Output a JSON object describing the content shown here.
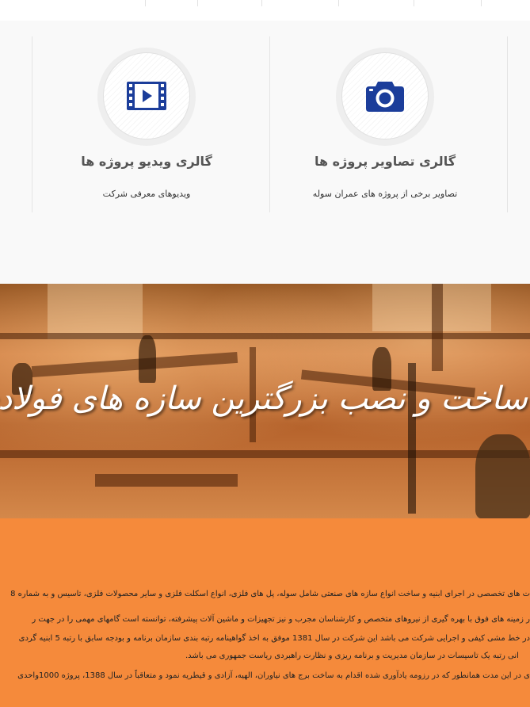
{
  "cards": [
    {
      "title": "گالری تصاویر پروژه ها",
      "subtitle": "تصاویر برخی از پروژه های عمران سوله",
      "icon": "camera-icon"
    },
    {
      "title": "گالری ویدیو پروژه ها",
      "subtitle": "ویدیوهای معرفی شرکت",
      "icon": "film-icon"
    }
  ],
  "banner": {
    "title": "ساخت و نصب بزرگترین سازه های فولادی"
  },
  "about": {
    "lines": [
      "ت های تخصصی در اجرای ابنیه و ساخت انواع سازه های صنعتی شامل سوله، پل های فلزی، انواع اسکلت فلزی و سایر محصولات فلزی، تاسیس و به شماره 8",
      "ر زمینه های فوق با بهره گیری از نیروهای متخصص و کارشناسان مجرب و نیز تجهیزات و ماشین آلات پیشرفته، توانسته است گامهای مهمی را در جهت ر",
      "در خط مشی کیفی و اجرایی شرکت می باشد این شرکت در سال 1381 موفق به اخذ گواهینامه رتبه بندی سازمان برنامه و بودجه سابق با رتبه 5 ابنیه گردی",
      "انی رتبه یک تاسیسات در سازمان مدیریت و برنامه ریزی و نظارت راهبردی ریاست جمهوری می باشد.",
      "ی در این مدت همانطور که در رزومه یادآوری شده اقدام به ساخت برج های نیاوران، الهیه، آزادی و قیطریه نمود و متعاقباً در سال 1388، پروژه 1000واحدی"
    ]
  },
  "colors": {
    "accent": "#f58a3b",
    "icon": "#1b3d9a"
  }
}
